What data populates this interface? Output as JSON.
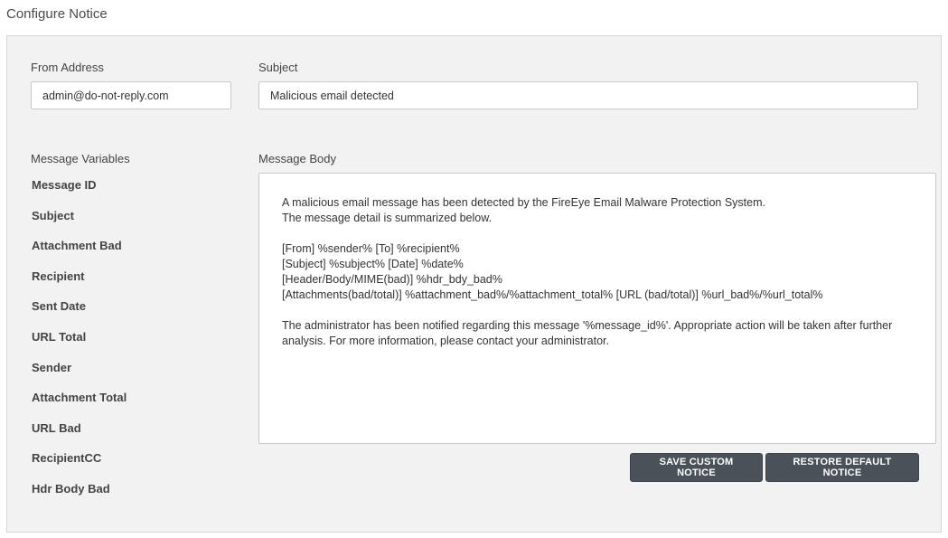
{
  "page": {
    "title": "Configure Notice"
  },
  "from_address": {
    "label": "From Address",
    "value": "admin@do-not-reply.com"
  },
  "subject": {
    "label": "Subject",
    "value": "Malicious email detected"
  },
  "message_variables": {
    "label": "Message Variables",
    "items": [
      "Message ID",
      "Subject",
      "Attachment Bad",
      "Recipient",
      "Sent Date",
      "URL Total",
      "Sender",
      "Attachment Total",
      "URL Bad",
      "RecipientCC",
      "Hdr Body Bad"
    ]
  },
  "message_body": {
    "label": "Message Body",
    "lines": [
      "A malicious email message has been detected by the FireEye Email Malware Protection System.",
      "The message detail is summarized below.",
      "",
      "[From] %sender% [To] %recipient%",
      "[Subject] %subject% [Date] %date%",
      "[Header/Body/MIME(bad)] %hdr_bdy_bad%",
      "[Attachments(bad/total)] %attachment_bad%/%attachment_total% [URL (bad/total)] %url_bad%/%url_total%",
      "",
      "The administrator has been notified regarding this message '%message_id%'. Appropriate action will be taken after further analysis. For more information, please contact your administrator."
    ]
  },
  "buttons": {
    "save": "SAVE CUSTOM NOTICE",
    "restore": "RESTORE DEFAULT NOTICE"
  }
}
